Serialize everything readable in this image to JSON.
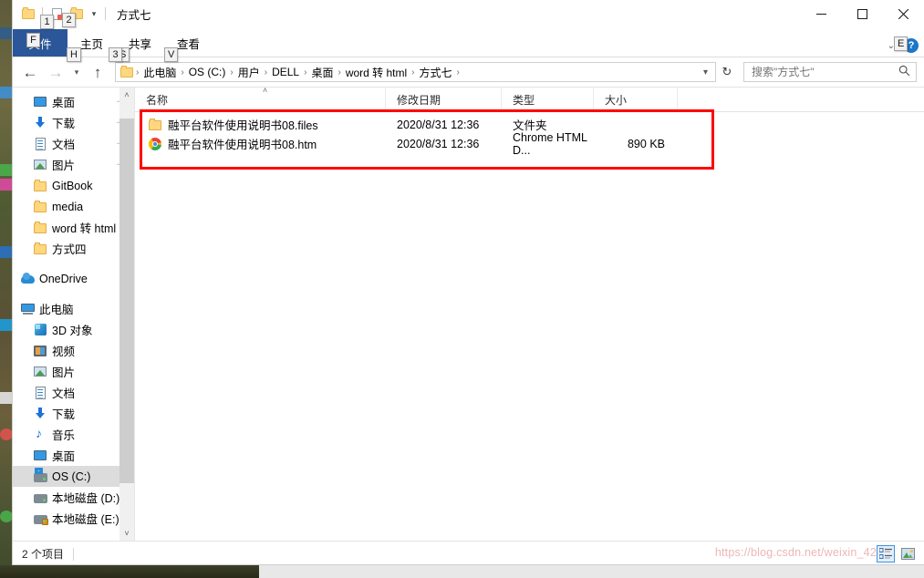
{
  "window": {
    "title": "方式七",
    "controls": {
      "minimize": "—",
      "maximize": "☐",
      "close": "✕"
    }
  },
  "quick_access_toolbar": {
    "items": [
      {
        "name": "folder-icon",
        "keytip": ""
      },
      {
        "name": "properties-icon",
        "keytip": "1"
      },
      {
        "name": "new-folder-icon",
        "keytip": "2"
      },
      {
        "name": "customize-qat-chevron",
        "keytip": ""
      }
    ]
  },
  "ribbon": {
    "tabs": [
      {
        "label": "文件",
        "keytip": "F",
        "active": true
      },
      {
        "label": "主页",
        "keytip": "H",
        "active": false
      },
      {
        "label": "共享",
        "keytip": "S",
        "active": false
      },
      {
        "label": "查看",
        "keytip": "V",
        "active": false
      }
    ],
    "expand_chevron": "⌄",
    "help_label": "?",
    "help_keytip": "E"
  },
  "nav_toolbar": {
    "back": "←",
    "forward": "→",
    "recent_locations": "⌄",
    "up": "↑",
    "up_keytip": "3"
  },
  "address_bar": {
    "breadcrumbs": [
      "此电脑",
      "OS (C:)",
      "用户",
      "DELL",
      "桌面",
      "word 转 html",
      "方式七"
    ],
    "separator": "›",
    "dropdown": "⌄",
    "refresh": "↻"
  },
  "search": {
    "placeholder": "搜索\"方式七\"",
    "icon": "⌕"
  },
  "nav_pane": {
    "items": [
      {
        "label": "桌面",
        "icon": "desktop-icon",
        "indent": 1,
        "pinned": true,
        "selected": false
      },
      {
        "label": "下载",
        "icon": "download-icon",
        "indent": 1,
        "pinned": true,
        "selected": false
      },
      {
        "label": "文档",
        "icon": "document-icon",
        "indent": 1,
        "pinned": true,
        "selected": false
      },
      {
        "label": "图片",
        "icon": "pictures-icon",
        "indent": 1,
        "pinned": true,
        "selected": false
      },
      {
        "label": "GitBook",
        "icon": "folder-icon",
        "indent": 1,
        "pinned": false,
        "selected": false
      },
      {
        "label": "media",
        "icon": "folder-icon",
        "indent": 1,
        "pinned": false,
        "selected": false
      },
      {
        "label": "word 转 html",
        "icon": "folder-icon",
        "indent": 1,
        "pinned": false,
        "selected": false
      },
      {
        "label": "方式四",
        "icon": "folder-icon",
        "indent": 1,
        "pinned": false,
        "selected": false
      },
      {
        "label": "",
        "icon": "spacer",
        "indent": 0,
        "pinned": false,
        "selected": false
      },
      {
        "label": "OneDrive",
        "icon": "onedrive-icon",
        "indent": 0,
        "pinned": false,
        "selected": false
      },
      {
        "label": "",
        "icon": "spacer",
        "indent": 0,
        "pinned": false,
        "selected": false
      },
      {
        "label": "此电脑",
        "icon": "this-pc-icon",
        "indent": 0,
        "pinned": false,
        "selected": false
      },
      {
        "label": "3D 对象",
        "icon": "3d-objects-icon",
        "indent": 1,
        "pinned": false,
        "selected": false
      },
      {
        "label": "视频",
        "icon": "videos-icon",
        "indent": 1,
        "pinned": false,
        "selected": false
      },
      {
        "label": "图片",
        "icon": "pictures-icon",
        "indent": 1,
        "pinned": false,
        "selected": false
      },
      {
        "label": "文档",
        "icon": "document-icon",
        "indent": 1,
        "pinned": false,
        "selected": false
      },
      {
        "label": "下载",
        "icon": "download-icon",
        "indent": 1,
        "pinned": false,
        "selected": false
      },
      {
        "label": "音乐",
        "icon": "music-icon",
        "indent": 1,
        "pinned": false,
        "selected": false
      },
      {
        "label": "桌面",
        "icon": "desktop-icon",
        "indent": 1,
        "pinned": false,
        "selected": false
      },
      {
        "label": "OS (C:)",
        "icon": "os-drive-icon",
        "indent": 1,
        "pinned": false,
        "selected": true
      },
      {
        "label": "本地磁盘 (D:)",
        "icon": "drive-icon",
        "indent": 1,
        "pinned": false,
        "selected": false
      },
      {
        "label": "本地磁盘 (E:)",
        "icon": "drive-locked-icon",
        "indent": 1,
        "pinned": false,
        "selected": false
      }
    ],
    "scroll_up": "˄",
    "scroll_down": "˅"
  },
  "file_list": {
    "columns": [
      "名称",
      "修改日期",
      "类型",
      "大小"
    ],
    "sort_caret": "˄",
    "rows": [
      {
        "name": "融平台软件使用说明书08.files",
        "icon": "folder-icon",
        "date": "2020/8/31 12:36",
        "type": "文件夹",
        "size": ""
      },
      {
        "name": "融平台软件使用说明书08.htm",
        "icon": "chrome-icon",
        "date": "2020/8/31 12:36",
        "type": "Chrome HTML D...",
        "size": "890 KB"
      }
    ]
  },
  "status_bar": {
    "item_count": "2 个项目",
    "watermark": "https://blog.csdn.net/weixin_42",
    "views": [
      {
        "name": "details-view-button",
        "active": true
      },
      {
        "name": "large-icons-view-button",
        "active": false
      }
    ]
  },
  "annotation": {
    "color": "#ff0000"
  }
}
